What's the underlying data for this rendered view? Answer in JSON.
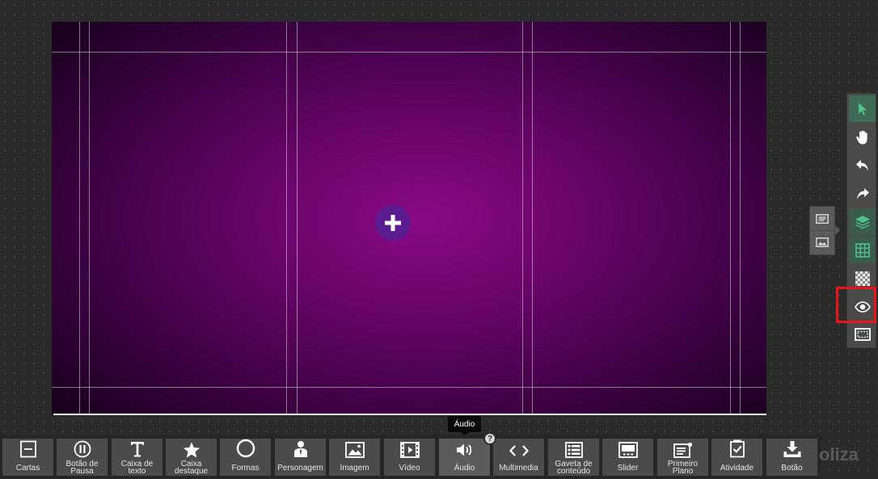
{
  "brand": {
    "text": "oliza"
  },
  "tooltip": {
    "text": "Áudio"
  },
  "help_badge": {
    "text": "?"
  },
  "canvas": {
    "add_icon": "plus-icon"
  },
  "right_toolbar": {
    "items": [
      {
        "name": "select-tool",
        "icon": "cursor-icon",
        "state": "active"
      },
      {
        "name": "pan-tool",
        "icon": "hand-icon"
      },
      {
        "name": "undo",
        "icon": "undo-icon"
      },
      {
        "name": "redo",
        "icon": "redo-icon"
      },
      {
        "name": "layers",
        "icon": "layers-icon",
        "state": "toggled"
      },
      {
        "name": "grid",
        "icon": "grid-icon",
        "state": "toggled"
      },
      {
        "name": "transparency",
        "icon": "checker-icon"
      },
      {
        "name": "preview",
        "icon": "eye-icon",
        "highlighted": true
      },
      {
        "name": "safe-area",
        "icon": "frame-icon"
      }
    ],
    "accent_color": "#3f6a56",
    "highlight_color": "#e8141a"
  },
  "mini_panel": {
    "items": [
      {
        "icon": "text-layer-icon"
      },
      {
        "icon": "image-layer-icon"
      }
    ]
  },
  "bottom_toolbar": {
    "selected": "Áudio",
    "tools": [
      {
        "label": "Cartas",
        "icon": "cards-icon"
      },
      {
        "label": "Botão de Pausa",
        "icon": "pause-icon"
      },
      {
        "label": "Caixa de texto",
        "icon": "text-icon"
      },
      {
        "label": "Caixa destaque",
        "icon": "star-icon"
      },
      {
        "label": "Formas",
        "icon": "circle-icon"
      },
      {
        "label": "Personagem",
        "icon": "person-icon"
      },
      {
        "label": "Imagem",
        "icon": "image-icon"
      },
      {
        "label": "Vídeo",
        "icon": "film-icon"
      },
      {
        "label": "Áudio",
        "icon": "speaker-icon"
      },
      {
        "label": "Multimedia",
        "icon": "code-icon"
      },
      {
        "label": "Gaveta de conteúdo",
        "icon": "drawer-icon"
      },
      {
        "label": "Slider",
        "icon": "slider-icon"
      },
      {
        "label": "Primeiro Plano",
        "icon": "foreground-icon"
      },
      {
        "label": "Atividade",
        "icon": "clipboard-check-icon"
      },
      {
        "label": "Botão",
        "icon": "download-icon"
      }
    ]
  },
  "colors": {
    "background": "#2b2b2b",
    "canvas_center": "#8a0a87",
    "canvas_edge": "#16011b",
    "add_button": "#5a1c8f"
  }
}
